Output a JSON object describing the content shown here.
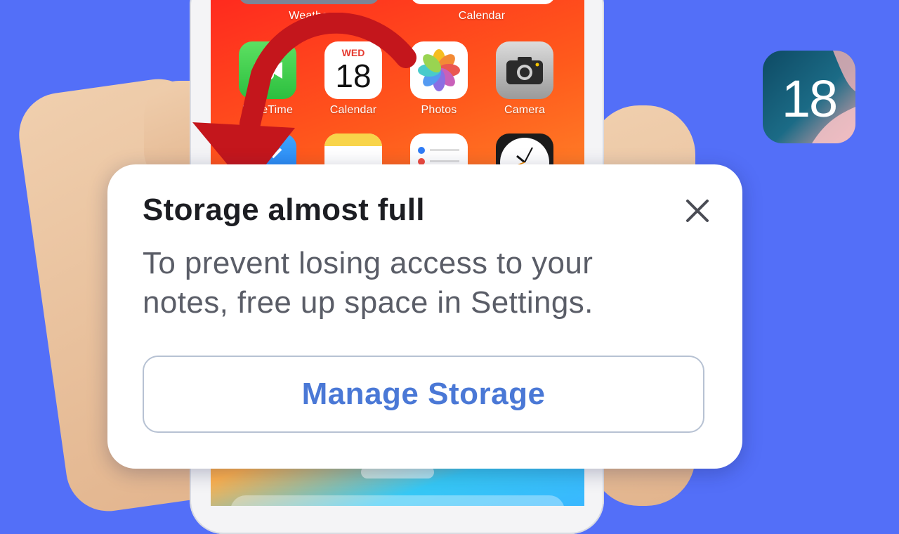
{
  "homescreen": {
    "widget_labels": [
      "Weather",
      "Calendar"
    ],
    "apps": [
      {
        "name": "FaceTime",
        "label": "FaceTime",
        "icon": "facetime-icon"
      },
      {
        "name": "Calendar",
        "label": "Calendar",
        "icon": "calendar-icon",
        "weekday": "WED",
        "day": "18"
      },
      {
        "name": "Photos",
        "label": "Photos",
        "icon": "photos-icon"
      },
      {
        "name": "Camera",
        "label": "Camera",
        "icon": "camera-icon"
      }
    ],
    "second_row_icons": [
      "mail-icon",
      "notes-icon",
      "reminders-icon",
      "clock-icon"
    ]
  },
  "alert": {
    "title": "Storage almost full",
    "message_line1": "To prevent losing access to your",
    "message_line2": "notes, free up space in Settings.",
    "close_icon": "close-icon",
    "action_label": "Manage Storage"
  },
  "badge": {
    "text": "18",
    "icon": "ios-18-logo"
  },
  "annotation": {
    "icon": "red-curved-arrow-icon",
    "color": "#c4161c"
  },
  "colors": {
    "background": "#536ff8",
    "action_text": "#4a78d6",
    "title_text": "#1c1d22",
    "message_text": "#5a5d67"
  }
}
